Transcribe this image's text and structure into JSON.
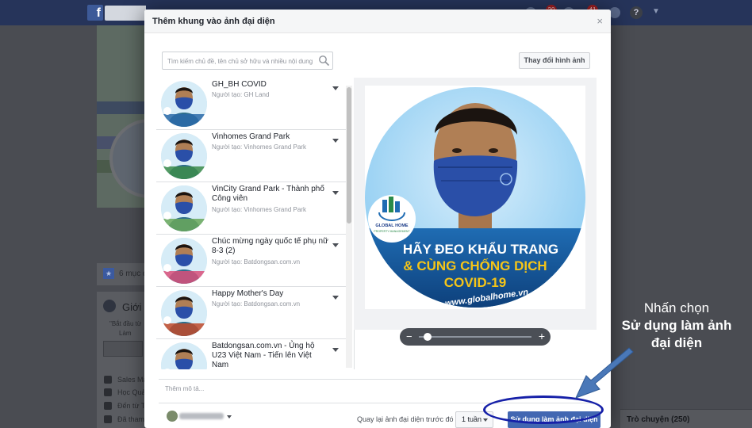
{
  "background_page": {
    "notifications": [
      "20",
      "",
      "41"
    ],
    "left_column": {
      "pages_count_text": "6 mục đ",
      "intro_title": "Giới t",
      "intro_snippet_1": "\"Bắt đầu từ",
      "intro_snippet_2": "Làm",
      "details": [
        "Sales Ma",
        "Học Quả",
        "Đến từ T",
        "Đã tham"
      ]
    },
    "chat_label": "Trò chuyện (250)"
  },
  "dialog": {
    "title": "Thêm khung vào ảnh đại diện",
    "close_label": "×",
    "search": {
      "placeholder": "Tìm kiếm chủ đề, tên chủ sở hữu và nhiều nội dung"
    },
    "change_photo_label": "Thay đổi hình ảnh",
    "frames": [
      {
        "name": "GH_BH COVID",
        "creator": "Người tạo: GH Land",
        "accent": "#2a6aa8"
      },
      {
        "name": "Vinhomes Grand Park",
        "creator": "Người tạo: Vinhomes Grand Park",
        "accent": "#3c8c4a"
      },
      {
        "name": "VinCity Grand Park - Thành phố Công viên",
        "creator": "Người tạo: Vinhomes Grand Park",
        "accent": "#6aa85a"
      },
      {
        "name": "Chúc mừng ngày quốc tế phụ nữ 8-3 (2)",
        "creator": "Người tạo: Batdongsan.com.vn",
        "accent": "#d9507a"
      },
      {
        "name": "Happy Mother's Day",
        "creator": "Người tạo: Batdongsan.com.vn",
        "accent": "#c04a2a"
      },
      {
        "name": "Batdongsan.com.vn - Ủng hộ U23 Việt Nam - Tiến lên Việt Nam",
        "creator": "",
        "accent": "#c02a2a"
      }
    ],
    "preview": {
      "logo_text_1": "GLOBAL HOME",
      "logo_text_2": "PROPERTY MANAGEMENT",
      "banner_line_1": "HÃY ĐEO KHẨU TRANG",
      "banner_line_2": "& CÙNG CHỐNG DỊCH",
      "banner_line_3": "COVID-19",
      "website": "www.globalhome.vn",
      "zoom_level": 0.05
    },
    "description": {
      "placeholder": "Thêm mô tả..."
    },
    "revert_label": "Quay lại ảnh đại diện trước đó",
    "duration": "1 tuần",
    "use_button_label": "Sử dụng làm ảnh đại diện"
  },
  "annotation": {
    "line1": "Nhấn chọn",
    "line2": "Sử dụng làm ảnh",
    "line3": "đại diện",
    "color": "#ffffff",
    "arrow_color": "#4a78b8",
    "highlight_color": "#1620a8"
  }
}
